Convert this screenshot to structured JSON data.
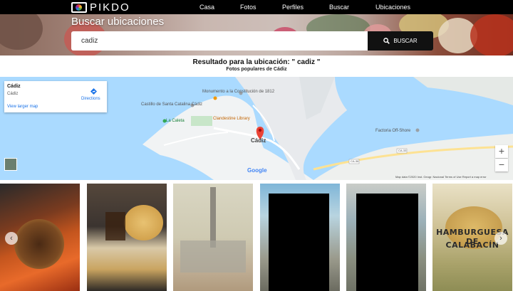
{
  "header": {
    "logo_text": "PIKDO",
    "nav": [
      "Casa",
      "Fotos",
      "Perfiles",
      "Buscar",
      "Ubicaciones"
    ]
  },
  "hero": {
    "title": "Buscar ubicaciones",
    "search_value": "cadiz",
    "search_button": "BUSCAR"
  },
  "results": {
    "title": "Resultado para la ubicación: \" cadiz \"",
    "subtitle": "Fotos populares de Cádiz"
  },
  "map": {
    "card_title": "Cádiz",
    "card_subtitle": "Cádiz",
    "larger_map": "View larger map",
    "directions": "Directions",
    "labels": {
      "monumento": "Monumento a la Constitución de 1812",
      "castillo": "Castillo de Santa Catalina Cádiz",
      "clandestine": "Clandestine Library",
      "caleta": "La Caleta",
      "cadiz": "Cádiz",
      "factoria": "Factoria Off-Shore",
      "ca33": "CA-33",
      "ca36": "CA-36"
    },
    "zoom_in": "+",
    "zoom_out": "−",
    "google": "Google",
    "footer": "Map data ©2020 Inst. Geogr. Nacional   Terms of Use   Report a map error"
  },
  "gallery": {
    "prev": "‹",
    "next": "›",
    "burger_line1": "HAMBURGUESA DE",
    "burger_line2": "CALABACÍN"
  },
  "colors": {
    "header_bg": "#000000",
    "button_bg": "#111111",
    "map_water": "#aadaff",
    "map_pin": "#ea4335"
  }
}
